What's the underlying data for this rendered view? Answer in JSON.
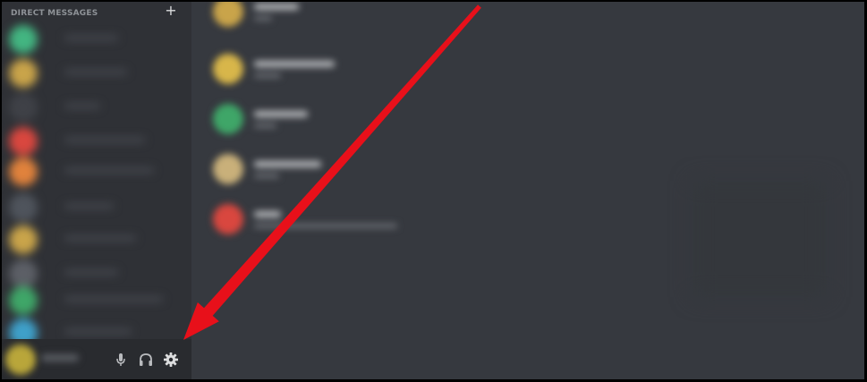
{
  "sidebar": {
    "header": "DIRECT MESSAGES",
    "add_icon": "plus-icon",
    "dm_avatar_colors": [
      "#43b581",
      "#c9a44a",
      "#3f4147",
      "#d9473f",
      "#e0823c",
      "#4f545c",
      "#c9a44a",
      "#5c5f66",
      "#3fa668",
      "#3fa0c9"
    ]
  },
  "user_panel": {
    "avatar_color": "#b9a63a",
    "controls": [
      "microphone-icon",
      "headphones-icon",
      "gear-icon"
    ]
  },
  "main": {
    "friend_avatar_colors": [
      "#c9a44a",
      "#d8b64a",
      "#3fa668",
      "#c9b07a",
      "#d9473f"
    ]
  },
  "annotation": {
    "arrow_color": "#e8101a",
    "points_to": "gear-icon"
  }
}
